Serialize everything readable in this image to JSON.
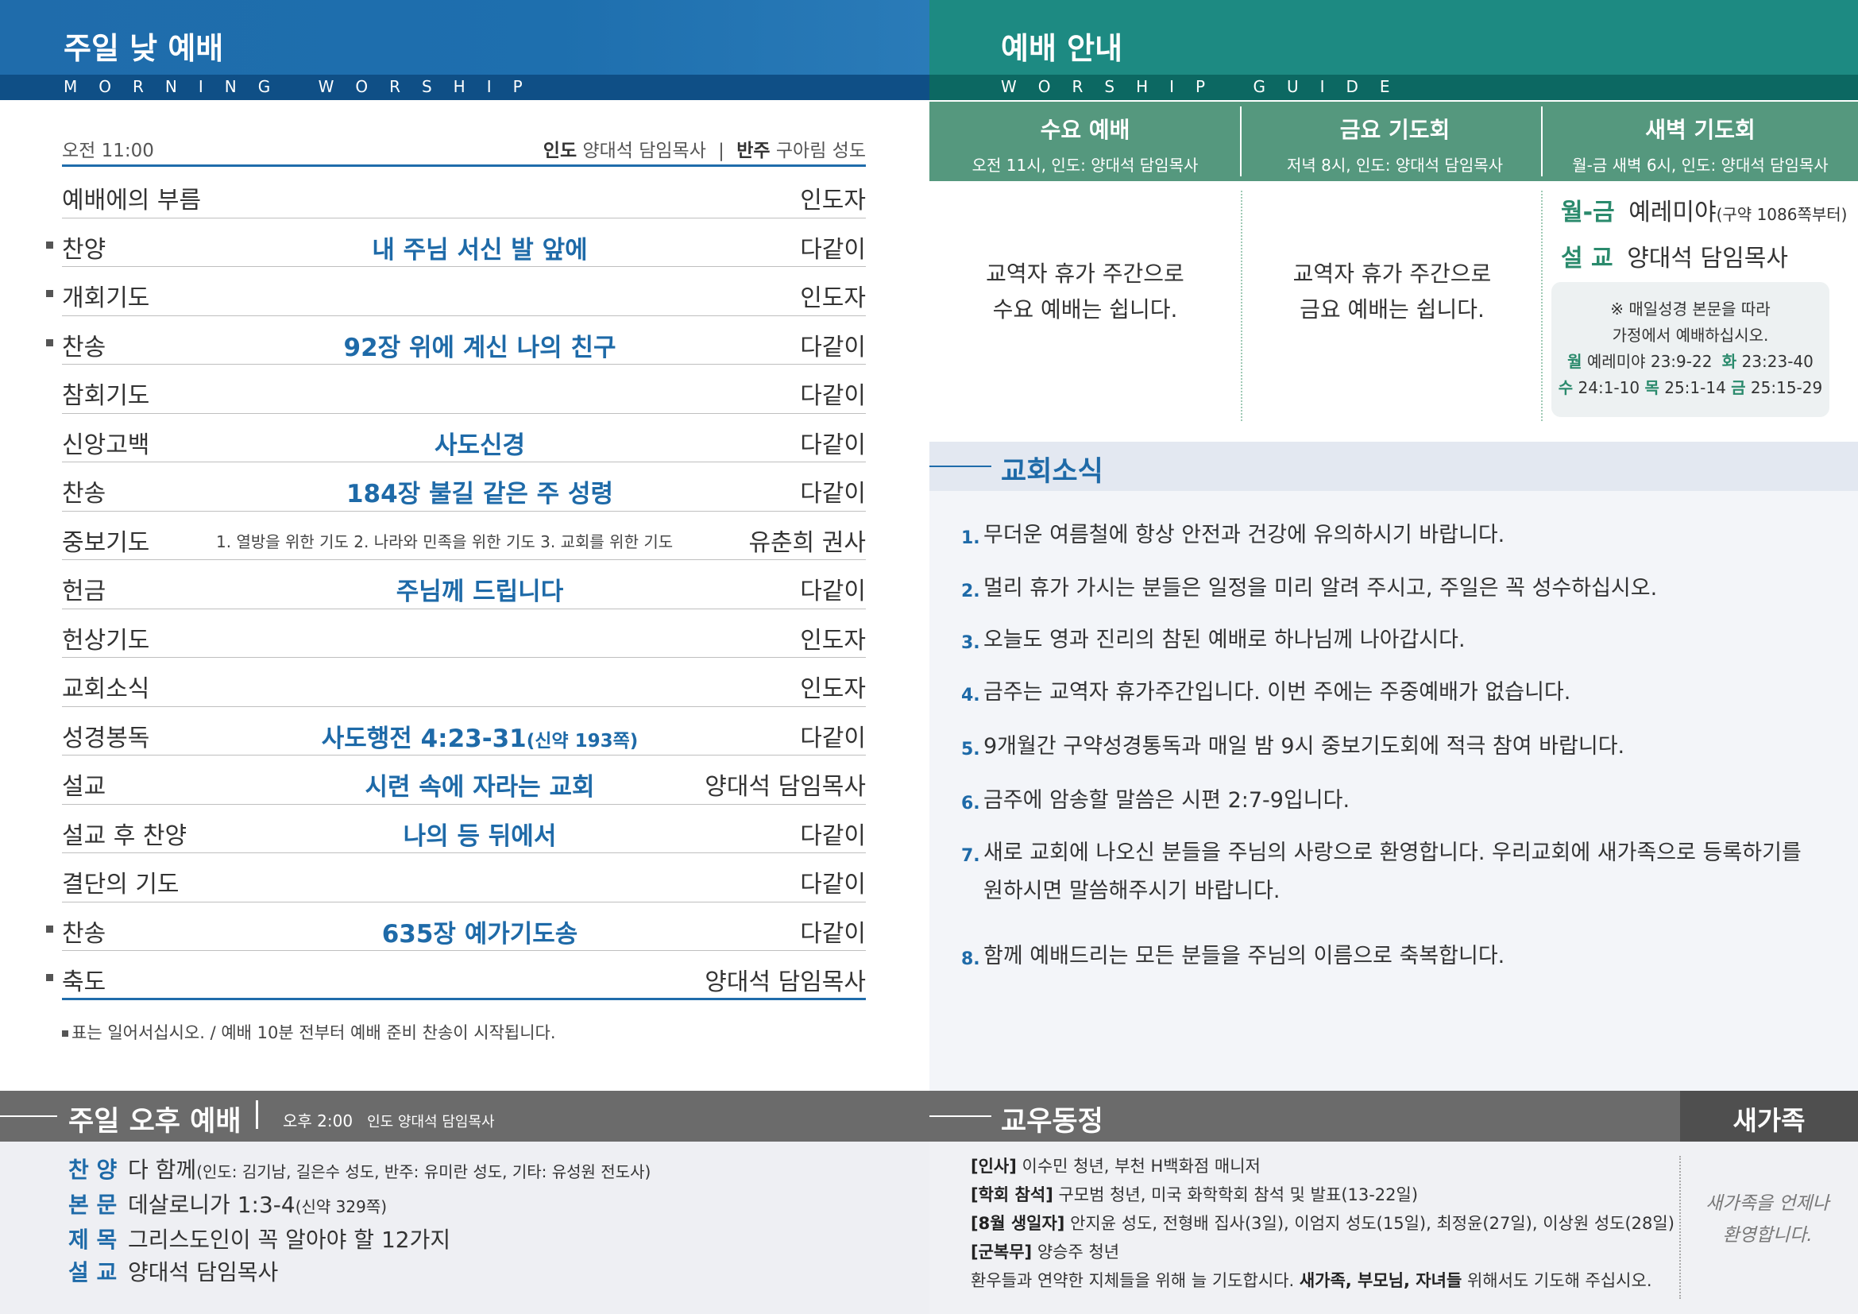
{
  "left_header": {
    "title": "주일 낮 예배",
    "subtitle": "MORNING WORSHIP"
  },
  "right_header": {
    "title": "예배 안내",
    "subtitle": "WORSHIP GUIDE"
  },
  "service": {
    "time": "오전 11:00",
    "leader_label": "인도",
    "leader": "양대석 담임목사",
    "separator": "|",
    "accompanist_label": "반주",
    "accompanist": "구아림 성도",
    "rows": [
      {
        "name": "예배에의 부름",
        "mid": "",
        "sub": "",
        "who": "인도자",
        "stand": false
      },
      {
        "name": "찬양",
        "mid": "내 주님 서신 발 앞에",
        "sub": "",
        "who": "다같이",
        "stand": true
      },
      {
        "name": "개회기도",
        "mid": "",
        "sub": "",
        "who": "인도자",
        "stand": true
      },
      {
        "name": "찬송",
        "mid": "92장 위에 계신 나의 친구",
        "sub": "",
        "who": "다같이",
        "stand": true
      },
      {
        "name": "참회기도",
        "mid": "",
        "sub": "",
        "who": "다같이",
        "stand": false
      },
      {
        "name": "신앙고백",
        "mid": "사도신경",
        "sub": "",
        "who": "다같이",
        "stand": false
      },
      {
        "name": "찬송",
        "mid": "184장 불길 같은 주 성령",
        "sub": "",
        "who": "다같이",
        "stand": false
      },
      {
        "name": "중보기도",
        "mid": "1. 열방을 위한 기도  2. 나라와 민족을 위한 기도  3. 교회를 위한 기도",
        "sub": "",
        "who": "유춘희 권사",
        "stand": false,
        "small": true
      },
      {
        "name": "헌금",
        "mid": "주님께 드립니다",
        "sub": "",
        "who": "다같이",
        "stand": false
      },
      {
        "name": "헌상기도",
        "mid": "",
        "sub": "",
        "who": "인도자",
        "stand": false
      },
      {
        "name": "교회소식",
        "mid": "",
        "sub": "",
        "who": "인도자",
        "stand": false
      },
      {
        "name": "성경봉독",
        "mid": "사도행전 4:23-31",
        "sub": "(신약 193쪽)",
        "who": "다같이",
        "stand": false
      },
      {
        "name": "설교",
        "mid": "시련 속에 자라는 교회",
        "sub": "",
        "who": "양대석 담임목사",
        "stand": false
      },
      {
        "name": "설교 후 찬양",
        "mid": "나의 등 뒤에서",
        "sub": "",
        "who": "다같이",
        "stand": false
      },
      {
        "name": "결단의 기도",
        "mid": "",
        "sub": "",
        "who": "다같이",
        "stand": false
      },
      {
        "name": "찬송",
        "mid": "635장 예가기도송",
        "sub": "",
        "who": "다같이",
        "stand": true
      },
      {
        "name": "축도",
        "mid": "",
        "sub": "",
        "who": "양대석 담임목사",
        "stand": true
      }
    ],
    "note": "표는 일어서십시오. / 예배 10분 전부터 예배 준비 찬송이 시작됩니다."
  },
  "guide": {
    "cols": [
      {
        "title": "수요 예배",
        "sub": "오전 11시, 인도: 양대석 담임목사",
        "line1": "교역자 휴가 주간으로",
        "line2": "수요 예배는 쉽니다."
      },
      {
        "title": "금요 기도회",
        "sub": "저녁 8시, 인도: 양대석 담임목사",
        "line1": "교역자 휴가 주간으로",
        "line2": "금요 예배는 쉽니다."
      },
      {
        "title": "새벽 기도회",
        "sub": "월-금 새벽 6시, 인도: 양대석 담임목사"
      }
    ],
    "dawn": {
      "k1": "월-금",
      "v1": "예레미야",
      "v1_small": "(구약 1086쪽부터)",
      "k2": "설 교",
      "v2": "양대석 담임목사",
      "box_line1": "※ 매일성경 본문을 따라",
      "box_line2": "가정에서 예배하십시오.",
      "d1": "월",
      "r1": "예레미야 23:9-22",
      "d2": "화",
      "r2": "23:23-40",
      "d3": "수",
      "r3": "24:1-10",
      "d4": "목",
      "r4": "25:1-14",
      "d5": "금",
      "r5": "25:15-29"
    }
  },
  "news": {
    "title": "교회소식",
    "items": [
      {
        "num": "1.",
        "text": "무더운 여름철에 항상 안전과 건강에 유의하시기 바랍니다."
      },
      {
        "num": "2.",
        "text": "멀리 휴가 가시는 분들은 일정을 미리 알려 주시고, 주일은 꼭 성수하십시오."
      },
      {
        "num": "3.",
        "text": "오늘도 영과 진리의 참된 예배로 하나님께 나아갑시다."
      },
      {
        "num": "4.",
        "text": "금주는 교역자 휴가주간입니다. 이번 주에는 주중예배가 없습니다."
      },
      {
        "num": "5.",
        "text": "9개월간 구약성경통독과 매일 밤 9시 중보기도회에 적극 참여 바랍니다."
      },
      {
        "num": "6.",
        "text": "금주에 암송할 말씀은 시편 2:7-9입니다."
      },
      {
        "num": "7.",
        "text": "새로 교회에 나오신 분들을 주님의 사랑으로 환영합니다. 우리교회에 새가족으로 등록하기를 원하시면 말씀해주시기 바랍니다."
      },
      {
        "num": "8.",
        "text": "함께 예배드리는 모든 분들을 주님의 이름으로 축복합니다."
      }
    ]
  },
  "afternoon": {
    "title": "주일 오후 예배",
    "time": "오후 2:00",
    "leader": "인도 양대석 담임목사",
    "items": [
      {
        "k": "찬 양",
        "v": "다 함께",
        "sm": "(인도: 김기남, 길은수 성도, 반주: 유미란 성도, 기타: 유성원 전도사)"
      },
      {
        "k": "본 문",
        "v": "데살로니가 1:3-4",
        "sm": "(신약 329쪽)"
      },
      {
        "k": "제 목",
        "v": "그리스도인이 꼭 알아야 할 12가지",
        "sm": ""
      },
      {
        "k": "설 교",
        "v": "양대석 담임목사",
        "sm": ""
      }
    ]
  },
  "members": {
    "title": "교우동정",
    "items": [
      {
        "k": "[인사]",
        "v": " 이수민 청년, 부천 H백화점 매니저"
      },
      {
        "k": "[학회 참석]",
        "v": " 구모범 청년, 미국 화학학회 참석 및 발표(13-22일)"
      },
      {
        "k": "[8월 생일자]",
        "v": " 안지윤 성도, 전형배 집사(3일), 이엄지 성도(15일), 최정윤(27일), 이상원 성도(28일)"
      },
      {
        "k": "[군복무]",
        "v": " 양승주 청년"
      }
    ],
    "prayer_a": "환우들과 연약한 지체들을 위해 늘 기도합시다. ",
    "prayer_b": "새가족, 부모님, 자녀들",
    "prayer_c": " 위해서도 기도해 주십시오."
  },
  "newfamily": {
    "title": "새가족",
    "line1": "새가족을 언제나",
    "line2": "환영합니다."
  }
}
